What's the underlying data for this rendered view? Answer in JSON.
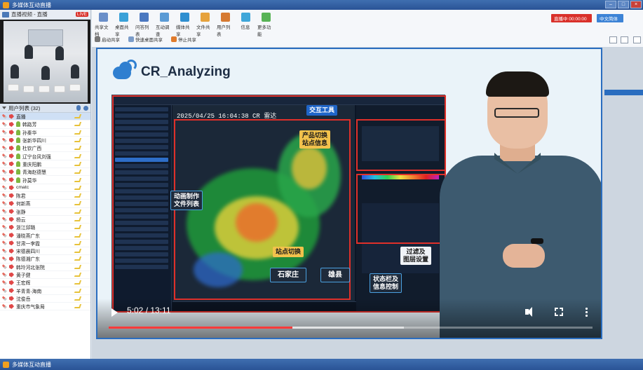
{
  "window": {
    "title": "多媒体互动直播",
    "icon": "app-logo-icon"
  },
  "left_panel": {
    "video_title": "直播视频 - 直播",
    "badge": "LIVE",
    "user_list_title": "用户列表 (32)",
    "users": [
      {
        "name": "直播",
        "host": true
      },
      {
        "name": "韩路芳"
      },
      {
        "name": "孙秦华"
      },
      {
        "name": "张新华四川"
      },
      {
        "name": "杜钦广西"
      },
      {
        "name": "辽宁台风刘强"
      },
      {
        "name": "重庆阳鹏"
      },
      {
        "name": "青海赵德慧"
      },
      {
        "name": "孙莫华"
      },
      {
        "name": "cmatc"
      },
      {
        "name": "陈君"
      },
      {
        "name": "何新燕"
      },
      {
        "name": "张静"
      },
      {
        "name": "杨云"
      },
      {
        "name": "浙江邱璐"
      },
      {
        "name": "潘晓燕广东"
      },
      {
        "name": "甘肃一李霞"
      },
      {
        "name": "宋德晨四川"
      },
      {
        "name": "陈德湘广东"
      },
      {
        "name": "韩玲河北张院"
      },
      {
        "name": "黄子健"
      },
      {
        "name": "王宏辉"
      },
      {
        "name": "羊青青-海南"
      },
      {
        "name": "沈俊岳"
      },
      {
        "name": "重庆市气象局"
      }
    ]
  },
  "toolbar": {
    "tools": [
      {
        "label": "共享文档",
        "icon": "doc-share-icon",
        "color": "#6a8fc9"
      },
      {
        "label": "桌面共享",
        "icon": "desktop-share-icon",
        "color": "#3aa1d8"
      },
      {
        "label": "问答列表",
        "icon": "qa-list-icon",
        "color": "#4b78c0"
      },
      {
        "label": "互动调查",
        "icon": "survey-icon",
        "color": "#5b9bd5"
      },
      {
        "label": "媒体共享",
        "icon": "media-share-icon",
        "color": "#2f8fd0"
      },
      {
        "label": "文件共享",
        "icon": "file-share-icon",
        "color": "#e6a23c"
      },
      {
        "label": "用户列表",
        "icon": "user-list-icon",
        "color": "#d67a32"
      },
      {
        "label": "信息",
        "icon": "info-icon",
        "color": "#3fa6d9"
      },
      {
        "label": "更多功能",
        "icon": "more-functions-icon",
        "color": "#58b356"
      }
    ],
    "subtools": [
      {
        "label": "启动共享",
        "icon": "start-share-icon",
        "color": "#777"
      },
      {
        "label": "快速桌面共享",
        "icon": "quick-desktop-icon",
        "color": "#7b9cc9"
      },
      {
        "label": "停止共享",
        "icon": "stop-share-icon",
        "color": "#e07b2c"
      }
    ],
    "live_button": "直播中 00:00:00",
    "lang_button": "中文简体"
  },
  "slide": {
    "title": "CR_Analyzing",
    "radar_header": "2025/04/25 16:04:38 CR 雷达",
    "callouts": {
      "interaction_tools": "交互工具",
      "product_station": "产品切换\n站点信息",
      "animation_list": "动画制作\n文件列表",
      "station_switch": "站点切换",
      "station_a": "石家庄",
      "station_b": "雄县",
      "status_bar": "状态栏及\n信息控制",
      "filter_layers": "过滤及\n图层设置"
    }
  },
  "player": {
    "time_current": "5:02",
    "time_total": "13:11",
    "time_display": "5:02 / 13:11",
    "progress": 0.38,
    "buffered": 0.61,
    "accent": "#ff3b3b"
  }
}
